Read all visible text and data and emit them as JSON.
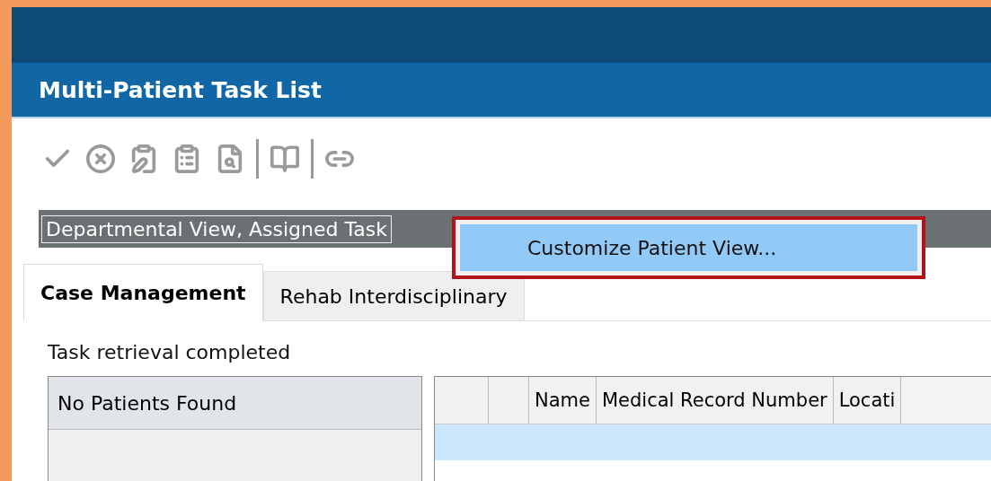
{
  "window": {
    "title": "Multi-Patient Task List"
  },
  "toolbar": {
    "buttons": [
      {
        "kind": "check",
        "disabled": true
      },
      {
        "kind": "cancel",
        "disabled": true
      },
      {
        "kind": "chart",
        "disabled": true
      },
      {
        "kind": "list",
        "disabled": true
      },
      {
        "kind": "search",
        "disabled": true
      },
      {
        "kind": "separator"
      },
      {
        "kind": "book",
        "disabled": true
      },
      {
        "kind": "separator"
      },
      {
        "kind": "link",
        "disabled": true
      }
    ]
  },
  "view_selector": {
    "value": "Departmental View, Assigned Task"
  },
  "context_menu": {
    "highlighted": true,
    "items": [
      {
        "label": "Customize Patient View...",
        "selected": true
      }
    ]
  },
  "tabs": [
    {
      "label": "Case Management",
      "selected": true
    },
    {
      "label": "Rehab Interdisciplinary",
      "selected": false
    }
  ],
  "status": "Task retrieval completed",
  "patient_list": {
    "header": "No Patients Found"
  },
  "task_table": {
    "columns": [
      "",
      "",
      "Name",
      "Medical Record Number",
      "Locati"
    ],
    "rows": [
      {
        "selected": true
      }
    ]
  }
}
